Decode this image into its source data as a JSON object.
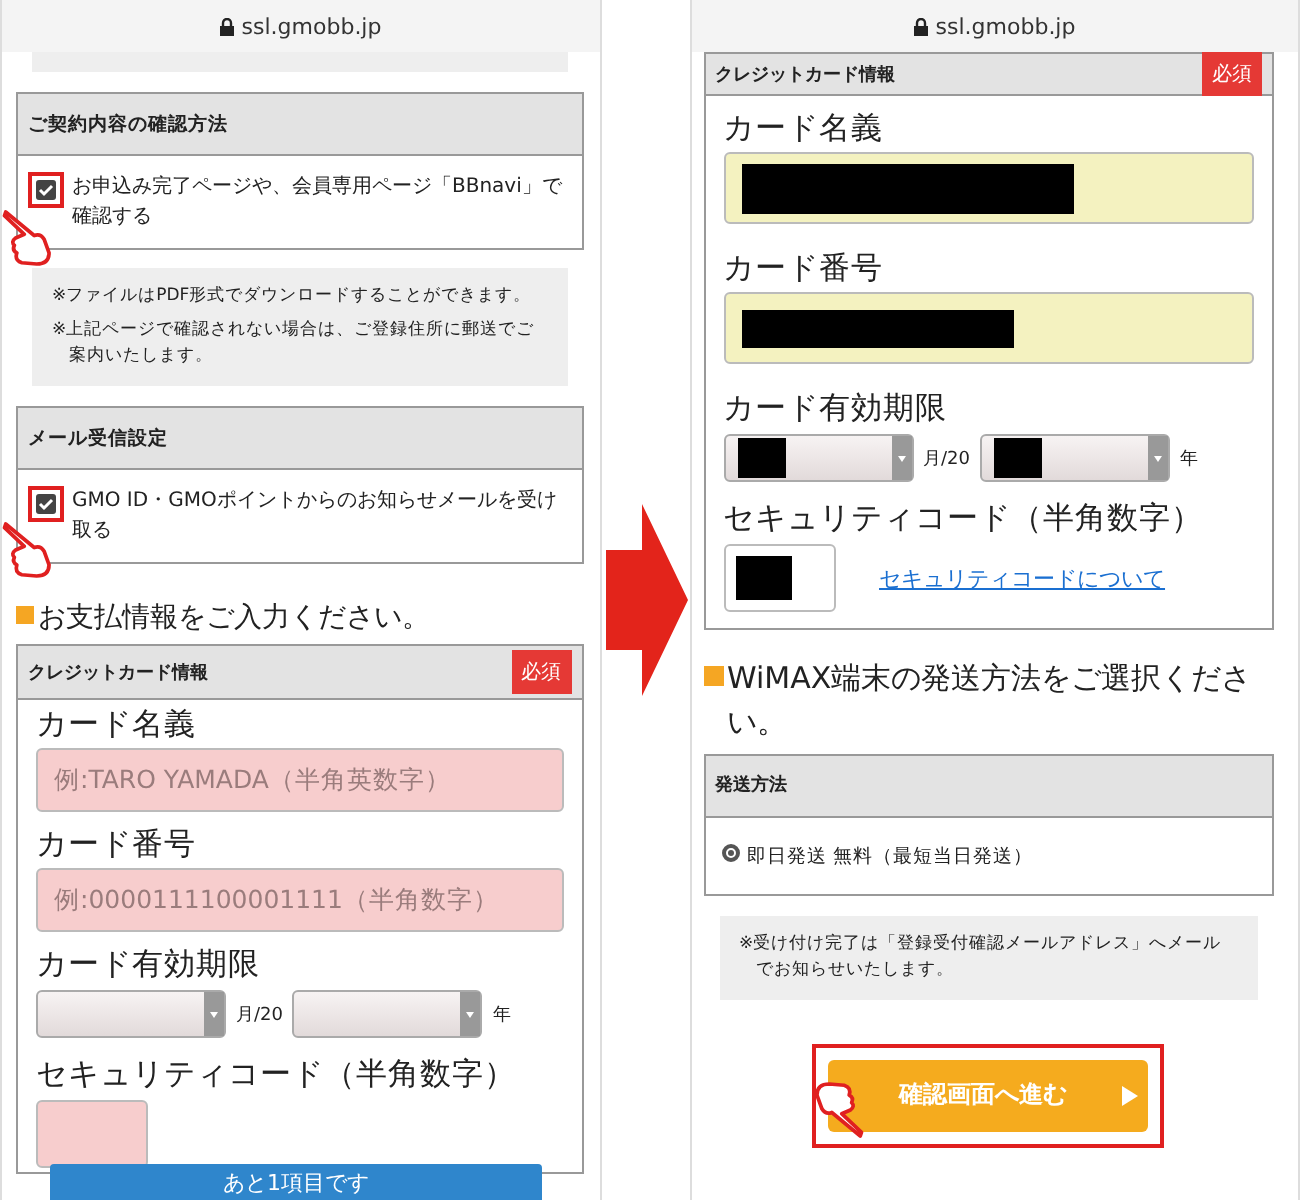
{
  "left_screen": {
    "url": "ssl.gmobb.jp",
    "sections": [
      {
        "title": "ご契約内容の確認方法",
        "option": {
          "label": "お申込み完了ページや、会員専用ページ「BBnavi」で確認する",
          "checked": true
        },
        "notes": [
          "※ファイルはPDF形式でダウンロードすることができます。",
          "※上記ページで確認されない場合は、ご登録住所に郵送でご案内いたします。"
        ]
      },
      {
        "title": "メール受信設定",
        "option": {
          "label": "GMO ID・GMOポイントからのお知らせメールを受け取る",
          "checked": true
        }
      }
    ],
    "heading": "お支払情報をご入力ください。",
    "card": {
      "title": "クレジットカード情報",
      "badge": "必須",
      "invalid": true,
      "fields": [
        {
          "label": "カード名義",
          "placeholder": "例:TARO YAMADA（半角英数字）",
          "redacted": false
        },
        {
          "label": "カード番号",
          "placeholder": "例:0000111100001111（半角数字）",
          "redacted": false
        }
      ],
      "expiry": {
        "label": "カード有効期限",
        "month_suffix": "月/20",
        "year_suffix": "年",
        "redacted": false
      },
      "security": {
        "label": "セキュリティコード（半角数字）",
        "redacted": false
      }
    },
    "tooltip": "あと1項目です"
  },
  "right_screen": {
    "url": "ssl.gmobb.jp",
    "card": {
      "title": "クレジットカード情報",
      "badge": "必須",
      "invalid": false,
      "fields": [
        {
          "label": "カード名義",
          "redacted": true
        },
        {
          "label": "カード番号",
          "redacted": true
        }
      ],
      "expiry": {
        "label": "カード有効期限",
        "month_suffix": "月/20",
        "year_suffix": "年",
        "redacted": true
      },
      "security": {
        "label": "セキュリティコード（半角数字）",
        "redacted": true,
        "link": "セキュリティコードについて"
      }
    },
    "heading": "WiMAX端末の発送方法をご選択ください。",
    "shipping": {
      "title": "発送方法",
      "options": [
        {
          "label": "即日発送 無料（最短当日発送）",
          "selected": true
        }
      ]
    },
    "note": "※受け付け完了は「登録受付確認メールアドレス」へメールでお知らせいたします。",
    "button": "確認画面へ進む"
  }
}
